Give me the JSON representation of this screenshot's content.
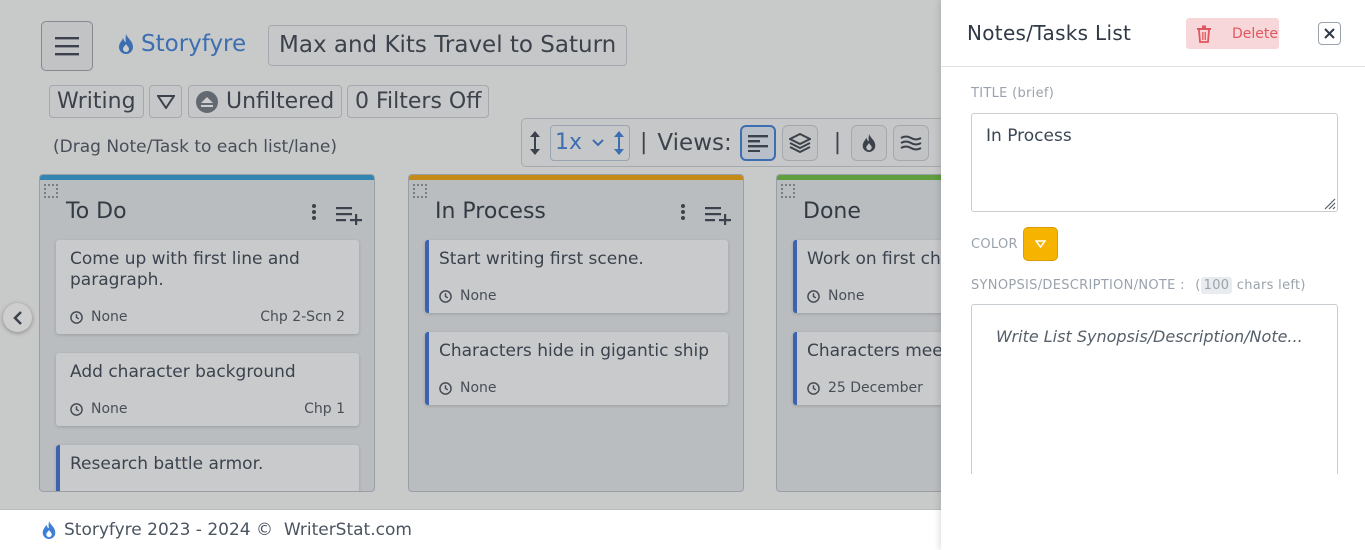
{
  "app": {
    "brand": "Storyfyre",
    "project_title": "Max and Kits Travel to Saturn",
    "mode_label": "Writing",
    "filter_label": "Unfiltered",
    "filters_off_label": "0 Filters Off",
    "drag_hint": "(Drag Note/Task to each list/lane)",
    "zoom_value": "1x",
    "views_label": "Views:",
    "separator": "|"
  },
  "lanes": [
    {
      "title": "To Do",
      "color": "#2f9fd8",
      "cards": [
        {
          "text": "Come up with first line and paragraph.",
          "date": "None",
          "chapter": "Chp 2-Scn 2",
          "accent": false
        },
        {
          "text": "Add character background",
          "date": "None",
          "chapter": "Chp 1",
          "accent": false
        },
        {
          "text": "Research battle armor.",
          "date": "",
          "chapter": "",
          "accent": true
        }
      ]
    },
    {
      "title": "In Process",
      "color": "#f2a60c",
      "cards": [
        {
          "text": "Start writing first scene.",
          "date": "None",
          "chapter": "",
          "accent": true
        },
        {
          "text": "Characters hide in gigantic ship",
          "date": "None",
          "chapter": "",
          "accent": true
        }
      ]
    },
    {
      "title": "Done",
      "color": "#6cbf3f",
      "cards": [
        {
          "text": "Work on first cha",
          "date": "None",
          "chapter": "",
          "accent": true
        },
        {
          "text": "Characters meet",
          "date": "25 December",
          "chapter": "",
          "accent": true
        }
      ]
    }
  ],
  "footer": {
    "text": "Storyfyre 2023 - 2024 ©  WriterStat.com"
  },
  "drawer": {
    "title": "Notes/Tasks List",
    "delete_label": "Delete",
    "title_field_label": "TITLE (brief)",
    "title_value": "In Process",
    "color_label": "COLOR",
    "color_value": "#f6b400",
    "synopsis_label": "SYNOPSIS/DESCRIPTION/NOTE :",
    "chars_left_prefix": "(",
    "chars_left_count": "100",
    "chars_left_suffix": " chars left)",
    "synopsis_placeholder": "Write List Synopsis/Description/Note..."
  }
}
